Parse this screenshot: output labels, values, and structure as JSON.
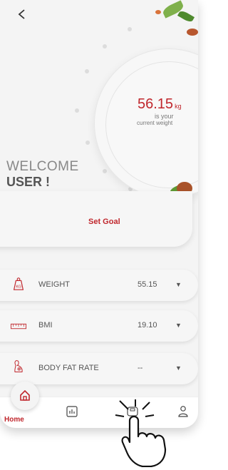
{
  "header": {
    "back_icon": "chevron-left-icon"
  },
  "weight_display": {
    "value": "56.15",
    "unit": "kg",
    "caption_line1": "is your",
    "caption_line2": "current weight"
  },
  "greeting": {
    "welcome": "WELCOME",
    "user": "USER !"
  },
  "goal": {
    "label": "Set Goal"
  },
  "metrics": [
    {
      "label": "WEIGHT",
      "value": "55.15",
      "icon": "weight-scale-icon"
    },
    {
      "label": "BMI",
      "value": "19.10",
      "icon": "ruler-icon"
    },
    {
      "label": "BODY FAT RATE",
      "value": "--",
      "icon": "body-fat-icon"
    }
  ],
  "nav": {
    "home_label": "Home",
    "items": [
      "home-icon",
      "chart-icon",
      "scale-icon",
      "profile-icon"
    ]
  },
  "colors": {
    "accent": "#c0272d",
    "background": "#f4f4f4"
  }
}
